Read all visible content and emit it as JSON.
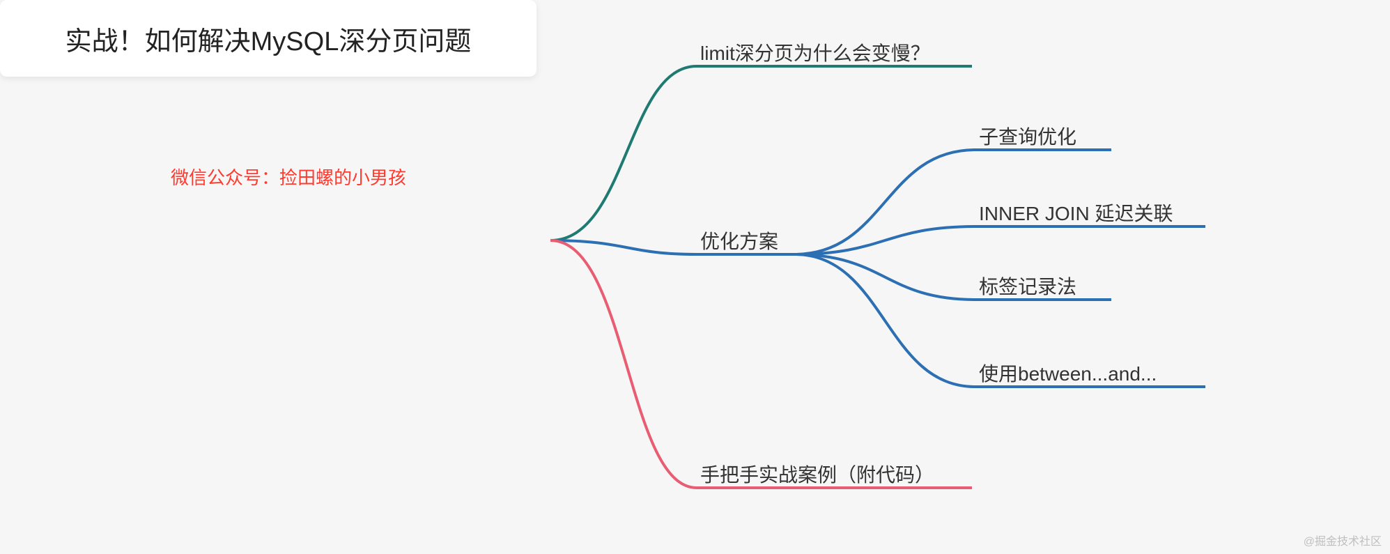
{
  "subtitle": "微信公众号：捡田螺的小男孩",
  "root": "实战！如何解决MySQL深分页问题",
  "branches": {
    "b1": {
      "label": "limit深分页为什么会变慢？",
      "color": "#1f7a72"
    },
    "b2": {
      "label": "优化方案",
      "color": "#2d6fb3",
      "children": {
        "c1": "子查询优化",
        "c2": "INNER JOIN 延迟关联",
        "c3": "标签记录法",
        "c4": "使用between...and..."
      }
    },
    "b3": {
      "label": "手把手实战案例（附代码）",
      "color": "#e85d72"
    }
  },
  "watermark": "@掘金技术社区",
  "chart_data": {
    "type": "mindmap",
    "root": "实战！如何解决MySQL深分页问题",
    "subtitle": "微信公众号：捡田螺的小男孩",
    "nodes": [
      {
        "id": "b1",
        "parent": "root",
        "label": "limit深分页为什么会变慢？",
        "color": "#1f7a72"
      },
      {
        "id": "b2",
        "parent": "root",
        "label": "优化方案",
        "color": "#2d6fb3"
      },
      {
        "id": "b2c1",
        "parent": "b2",
        "label": "子查询优化",
        "color": "#2d6fb3"
      },
      {
        "id": "b2c2",
        "parent": "b2",
        "label": "INNER JOIN 延迟关联",
        "color": "#2d6fb3"
      },
      {
        "id": "b2c3",
        "parent": "b2",
        "label": "标签记录法",
        "color": "#2d6fb3"
      },
      {
        "id": "b2c4",
        "parent": "b2",
        "label": "使用between...and...",
        "color": "#2d6fb3"
      },
      {
        "id": "b3",
        "parent": "root",
        "label": "手把手实战案例（附代码）",
        "color": "#e85d72"
      }
    ]
  }
}
